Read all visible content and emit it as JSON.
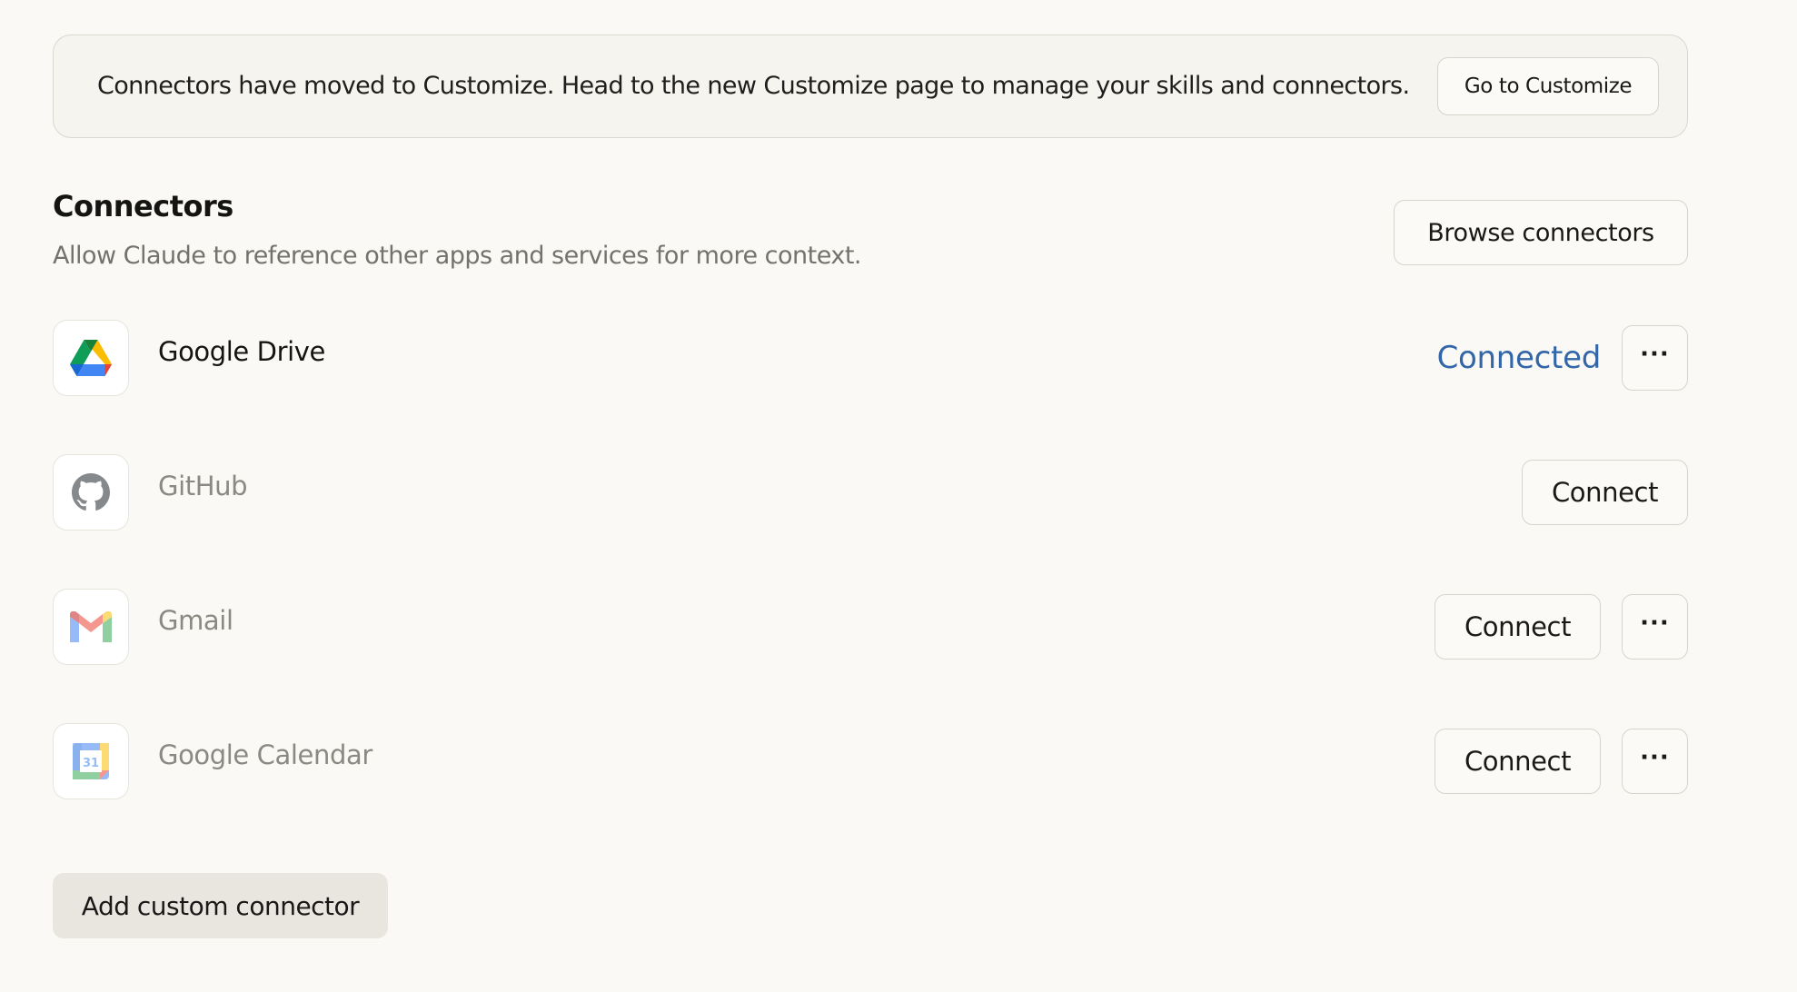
{
  "banner": {
    "text": "Connectors have moved to Customize. Head to the new Customize page to manage your skills and connectors.",
    "button_label": "Go to Customize"
  },
  "section": {
    "title": "Connectors",
    "subtitle": "Allow Claude to reference other apps and services for more context.",
    "browse_label": "Browse connectors"
  },
  "connectors": [
    {
      "name": "Google Drive",
      "icon": "google-drive-icon",
      "status": "Connected",
      "more_label": "···"
    },
    {
      "name": "GitHub",
      "icon": "github-icon",
      "connect_label": "Connect"
    },
    {
      "name": "Gmail",
      "icon": "gmail-icon",
      "connect_label": "Connect",
      "more_label": "···"
    },
    {
      "name": "Google Calendar",
      "icon": "google-calendar-icon",
      "calendar_day": "31",
      "connect_label": "Connect",
      "more_label": "···"
    }
  ],
  "add_custom_label": "Add custom connector",
  "colors": {
    "background": "#faf9f5",
    "connected": "#3366a8",
    "muted_text": "#73726c"
  }
}
